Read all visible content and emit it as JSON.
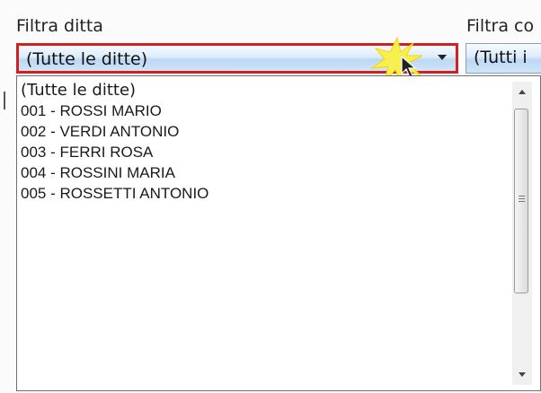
{
  "filters": {
    "ditta_label": "Filtra ditta",
    "second_label": "Filtra co",
    "ditta_selected": "(Tutte le ditte)",
    "second_selected": "(Tutti i"
  },
  "dropdown": {
    "items": [
      "(Tutte le ditte)",
      "001 - ROSSI MARIO",
      "002 - VERDI ANTONIO",
      "003 - FERRI ROSA",
      "004 - ROSSINI MARIA",
      "005 - ROSSETTI ANTONIO"
    ]
  },
  "colors": {
    "highlight_border": "#d02020",
    "combo_gradient_mid": "#bcd8f4",
    "burst": "#f7f050"
  },
  "icons": {
    "dropdown_arrow": "chevron-down-icon",
    "cursor": "mouse-pointer-icon",
    "click_burst": "click-burst-icon",
    "scroll_up": "scroll-up-arrow-icon",
    "scroll_down": "scroll-down-arrow-icon"
  }
}
